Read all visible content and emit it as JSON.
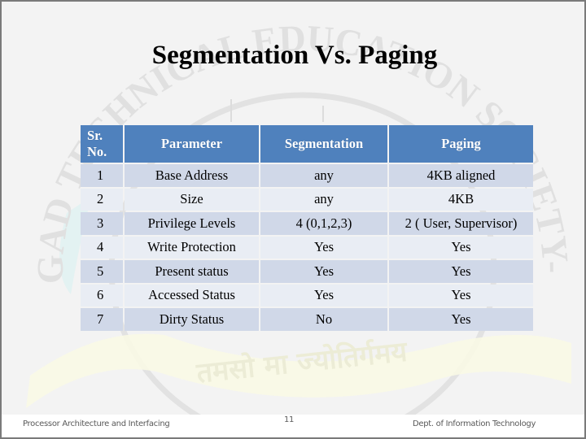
{
  "slide": {
    "title": "Segmentation Vs. Paging",
    "watermark": {
      "org_text": "SINHGAD TECHNICAL EDUCATION SOCIETY-PUNE",
      "motto": "तमसो मा ज्योतिर्गमय"
    }
  },
  "table": {
    "headers": [
      "Sr. No.",
      "Parameter",
      "Segmentation",
      "Paging"
    ],
    "rows": [
      {
        "sr": "1",
        "parameter": "Base Address",
        "segmentation": "any",
        "paging": "4KB aligned"
      },
      {
        "sr": "2",
        "parameter": "Size",
        "segmentation": "any",
        "paging": "4KB"
      },
      {
        "sr": "3",
        "parameter": "Privilege Levels",
        "segmentation": "4 (0,1,2,3)",
        "paging": "2 ( User, Supervisor)"
      },
      {
        "sr": "4",
        "parameter": "Write Protection",
        "segmentation": "Yes",
        "paging": "Yes"
      },
      {
        "sr": "5",
        "parameter": "Present status",
        "segmentation": "Yes",
        "paging": "Yes"
      },
      {
        "sr": "6",
        "parameter": "Accessed Status",
        "segmentation": "Yes",
        "paging": "Yes"
      },
      {
        "sr": "7",
        "parameter": "Dirty Status",
        "segmentation": "No",
        "paging": "Yes"
      }
    ]
  },
  "footer": {
    "left": "Processor Architecture and Interfacing",
    "page_number": "11",
    "right": "Dept. of Information Technology"
  },
  "colors": {
    "header_bg": "#4f81bd",
    "row_dark": "#d0d8e8",
    "row_light": "#e9edf4",
    "slide_bg": "#f3f3f3"
  }
}
